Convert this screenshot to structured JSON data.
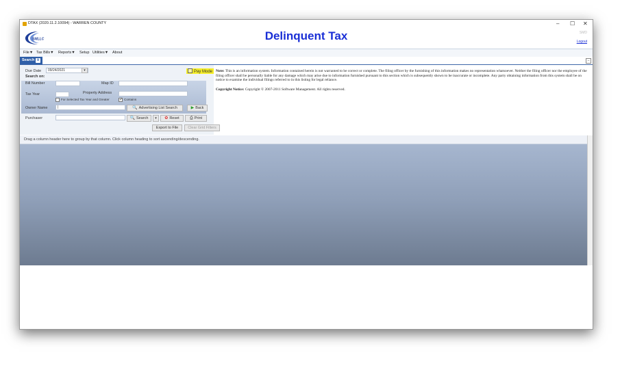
{
  "window": {
    "title": "DTAX (2020.11.2.10094) - WARREN COUNTY",
    "controls": {
      "minimize": "–",
      "maximize": "☐",
      "close": "✕"
    }
  },
  "header": {
    "logo_text": "SMLLC",
    "app_title": "Delinquent Tax",
    "user": "SMD",
    "logout": "Logout"
  },
  "menu": {
    "items": [
      "File▼",
      "Tax Bills▼",
      "Reports▼",
      "Setup",
      "Utilities▼",
      "About"
    ]
  },
  "tab": {
    "label": "Search",
    "close": "x"
  },
  "search": {
    "due_date_label": "Due Date",
    "due_date_value": "09/24/2021",
    "search_on_label": "Search on:",
    "bill_number_label": "Bill Number",
    "map_id_label": "Map ID",
    "tax_year_label": "Tax Year",
    "property_address_label": "Property Address",
    "for_selected_label": "For Selected Tax Year and Greater",
    "contains_label": "Contains",
    "owner_name_label": "Owner Name",
    "purchaser_label": "Purchaser",
    "pay_mode_label": "Pay Mode",
    "buttons": {
      "advertising": "Advertising List Search",
      "back": "Back",
      "search": "Search",
      "reset": "Reset",
      "print": "Print",
      "export": "Export to File",
      "clear": "Clear Grid Filters"
    }
  },
  "notice": {
    "note_label": "Note:",
    "note_text": " This is an information system. Information contained herein is not warranted to be correct or complete. The filing officer by the furnishing of this information makes no representation whatsoever. Neither the filing officer nor the employee of the filing officer shall be personally liable for any damage which may arise due to information furnished pursuant to this section which is subsequently shown to be inaccurate or incomplete. Any party obtaining information from this system shall be on notice to examine the individual filings referred to in this listing for legal reliance.",
    "copyright_label": "Copyright Notice:",
    "copyright_text": " Copyright © 2007-2011 Software Management. All rights reserved."
  },
  "grid": {
    "group_hint": "Drag a column header here to group by that column. Click column heading to sort ascending/descending."
  },
  "colors": {
    "title": "#1a2fd6",
    "tab": "#2f5fa8",
    "pay_mode": "#f6ee27"
  }
}
